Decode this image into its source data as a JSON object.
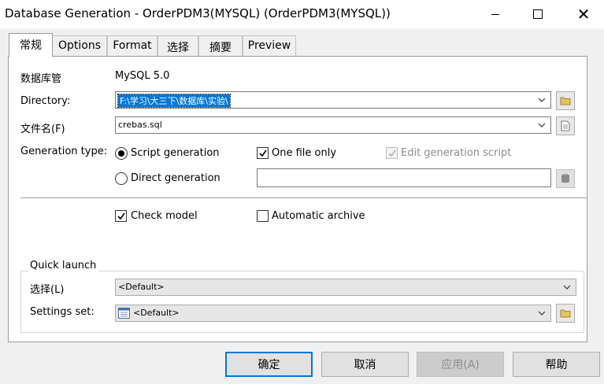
{
  "window": {
    "title": "Database Generation - OrderPDM3(MYSQL) (OrderPDM3(MYSQL))"
  },
  "tabs": [
    {
      "label": "常规",
      "active": true
    },
    {
      "label": "Options",
      "active": false
    },
    {
      "label": "Format",
      "active": false
    },
    {
      "label": "选择",
      "active": false
    },
    {
      "label": "摘要",
      "active": false
    },
    {
      "label": "Preview",
      "active": false
    }
  ],
  "general": {
    "dbms_label": "数据库管",
    "dbms_value": "MySQL 5.0",
    "directory_label": "Directory:",
    "directory_value": "F:\\学习\\大三下\\数据库\\实验\\",
    "filename_label": "文件名(F)",
    "filename_value": "crebas.sql",
    "generation_type_label": "Generation type:",
    "script_generation": "Script generation",
    "direct_generation": "Direct generation",
    "one_file_only": "One file only",
    "edit_generation_script": "Edit generation script",
    "direct_value": "",
    "check_model": "Check model",
    "automatic_archive": "Automatic archive"
  },
  "quick_launch": {
    "title": "Quick launch",
    "selection_label": "选择(L)",
    "selection_value": "<Default>",
    "settings_label": "Settings set:",
    "settings_value": "<Default>"
  },
  "states": {
    "script_generation": true,
    "direct_generation": false,
    "one_file_only": true,
    "edit_generation_script": true,
    "check_model": true,
    "automatic_archive": false
  },
  "buttons": {
    "ok": "确定",
    "cancel": "取消",
    "apply": "应用(A)",
    "help": "帮助"
  },
  "colors": {
    "selection": "#0078d7",
    "default_button_border": "#0078d7",
    "disabled_text": "#8c8c8c"
  }
}
